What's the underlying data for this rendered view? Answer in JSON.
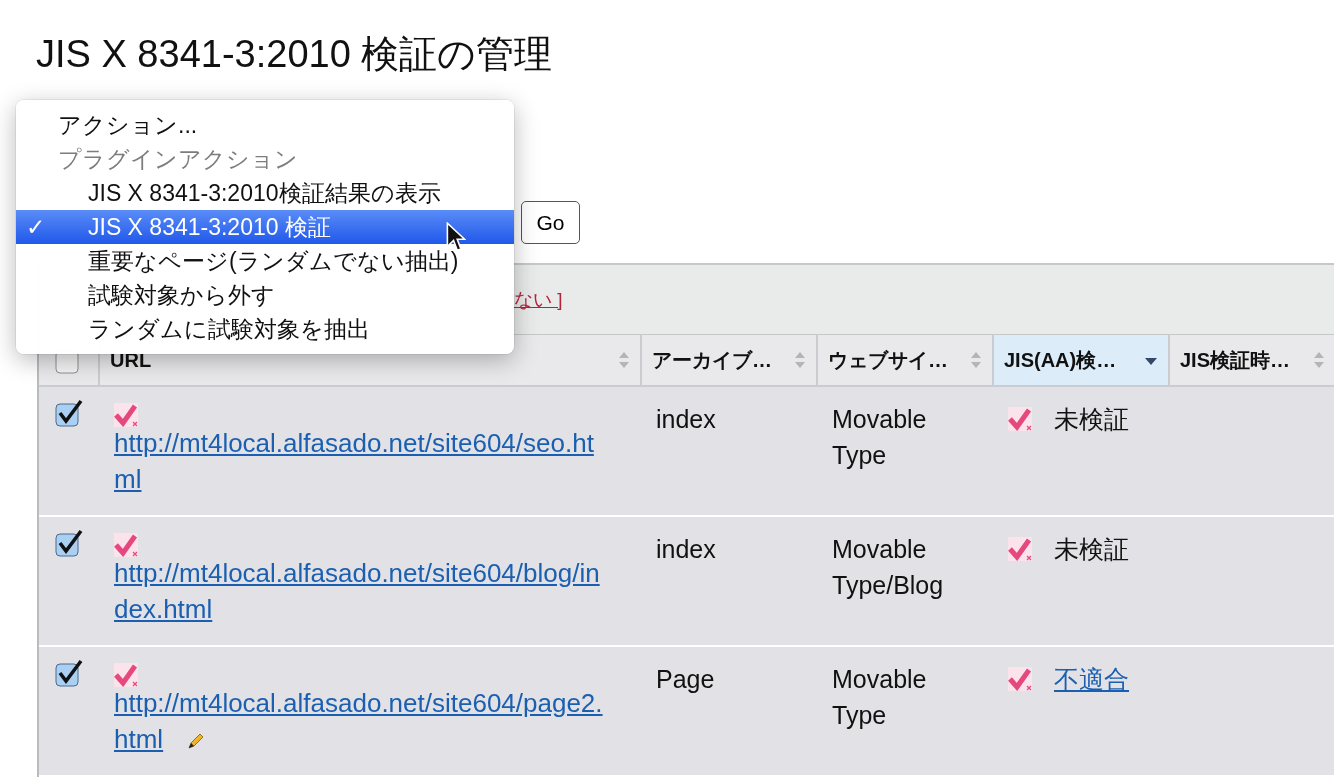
{
  "title": "JIS X 8341-3:2010 検証の管理",
  "action_menu": {
    "items": [
      {
        "kind": "placeholder",
        "label": "アクション...",
        "selected": false
      },
      {
        "kind": "group",
        "label": "プラグインアクション",
        "selected": false
      },
      {
        "kind": "option",
        "label": "JIS X 8341-3:2010検証結果の表示",
        "selected": false
      },
      {
        "kind": "option",
        "label": "JIS X 8341-3:2010 検証",
        "selected": true
      },
      {
        "kind": "option",
        "label": "重要なページ(ランダムでない抽出)",
        "selected": false
      },
      {
        "kind": "option",
        "label": "試験対象から外す",
        "selected": false
      },
      {
        "kind": "option",
        "label": "ランダムに試験対象を抽出",
        "selected": false
      }
    ],
    "check_mark": "✓"
  },
  "go_button": "Go",
  "filter_link": "ない ]",
  "table": {
    "select_all_checked": false,
    "columns": [
      {
        "label": "URL",
        "sorted": false,
        "active": false
      },
      {
        "label": "アーカイブ…",
        "sorted": false,
        "active": false
      },
      {
        "label": "ウェブサイ…",
        "sorted": false,
        "active": false
      },
      {
        "label": "JIS(AA)検…",
        "sorted": true,
        "active": true
      },
      {
        "label": "JIS検証時…",
        "sorted": false,
        "active": false
      }
    ],
    "rows": [
      {
        "checked": true,
        "url": "http://mt4local.alfasado.net/site604/seo.html",
        "editable": false,
        "archive": "index",
        "website": "Movable Type",
        "status": "未検証",
        "status_is_link": false
      },
      {
        "checked": true,
        "url": "http://mt4local.alfasado.net/site604/blog/index.html",
        "editable": false,
        "archive": "index",
        "website": "Movable Type/Blog",
        "status": "未検証",
        "status_is_link": false
      },
      {
        "checked": true,
        "url": "http://mt4local.alfasado.net/site604/page2.html",
        "editable": true,
        "archive": "Page",
        "website": "Movable Type",
        "status": "不適合",
        "status_is_link": true
      }
    ]
  }
}
